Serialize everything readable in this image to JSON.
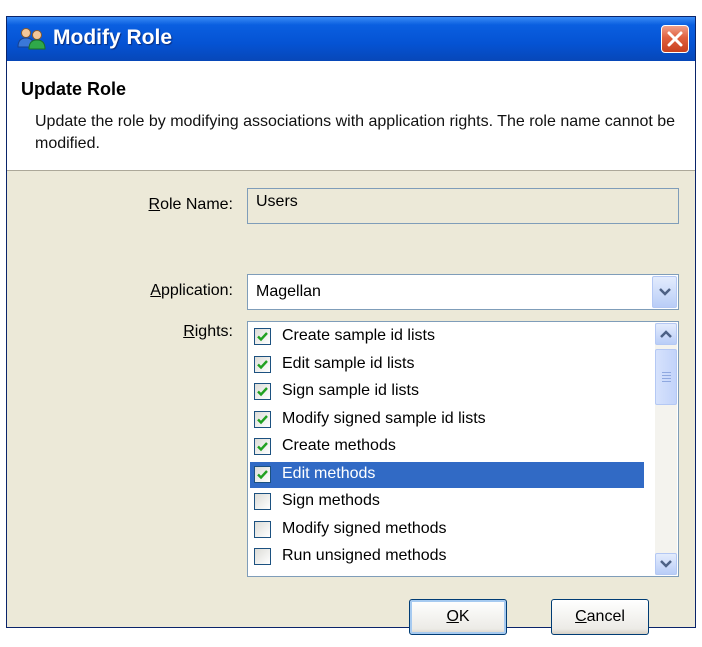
{
  "window": {
    "title": "Modify Role"
  },
  "header": {
    "title": "Update Role",
    "description": "Update the role by modifying associations with application rights. The role name cannot be modified."
  },
  "form": {
    "role_name": {
      "label_key": "R",
      "label_rest": "ole Name:",
      "value": "Users"
    },
    "application": {
      "label_key": "A",
      "label_rest": "pplication:",
      "value": "Magellan"
    },
    "rights": {
      "label_key": "R",
      "label_rest": "ights:"
    }
  },
  "rights_items": [
    {
      "label": "Create sample id lists",
      "checked": true,
      "selected": false
    },
    {
      "label": "Edit sample id lists",
      "checked": true,
      "selected": false
    },
    {
      "label": "Sign sample id lists",
      "checked": true,
      "selected": false
    },
    {
      "label": "Modify signed sample id lists",
      "checked": true,
      "selected": false
    },
    {
      "label": "Create methods",
      "checked": true,
      "selected": false
    },
    {
      "label": "Edit methods",
      "checked": true,
      "selected": true
    },
    {
      "label": "Sign methods",
      "checked": false,
      "selected": false
    },
    {
      "label": "Modify signed methods",
      "checked": false,
      "selected": false
    },
    {
      "label": "Run unsigned methods",
      "checked": false,
      "selected": false
    }
  ],
  "buttons": {
    "ok": {
      "key": "O",
      "rest": "K"
    },
    "cancel": {
      "key": "C",
      "rest": "ancel"
    }
  },
  "colors": {
    "titlebar": "#0553d4",
    "selection": "#316ac5",
    "dialog_bg": "#ece9d8",
    "check": "#21a121"
  },
  "icons": {
    "title": "users-icon",
    "close": "close-icon",
    "dropdown": "chevron-down-icon"
  }
}
